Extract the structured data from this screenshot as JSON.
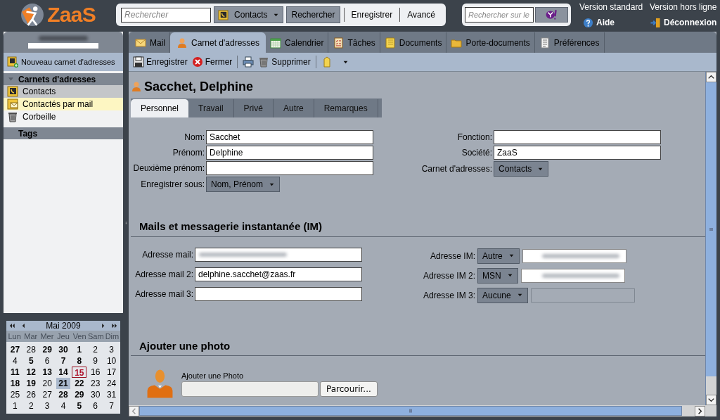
{
  "logo": {
    "text": "ZaaS"
  },
  "search": {
    "placeholder": "Rechercher",
    "scope": "Contacts",
    "buttons": [
      {
        "label": "Rechercher",
        "kind": "button"
      },
      {
        "label": "Enregistrer",
        "kind": "link"
      },
      {
        "label": "Avancé",
        "kind": "link"
      }
    ]
  },
  "web_search": {
    "placeholder": "Rechercher sur le"
  },
  "top_links": [
    {
      "label": "Version standard",
      "kind": "plain"
    },
    {
      "label": "Version hors ligne",
      "kind": "plain"
    },
    {
      "label": "Aide",
      "kind": "help"
    },
    {
      "label": "Déconnexion",
      "kind": "logout"
    }
  ],
  "sidebar": {
    "new_button": "Nouveau carnet d'adresses",
    "sections": [
      {
        "title": "Carnets d'adresses",
        "items": [
          {
            "label": "Contacts",
            "kind": "contacts",
            "selected": true,
            "highlighted": false
          },
          {
            "label": "Contactés par mail",
            "kind": "mailed",
            "selected": false,
            "highlighted": true
          },
          {
            "label": "Corbeille",
            "kind": "trash",
            "selected": false,
            "highlighted": false
          }
        ]
      },
      {
        "title": "Tags"
      }
    ]
  },
  "calendar": {
    "month": "Mai 2009",
    "weekdays": [
      "Lun",
      "Mar",
      "Mer",
      "Jeu",
      "Ven",
      "Sam",
      "Dim"
    ],
    "weeks": [
      [
        {
          "day": "27",
          "bold": true
        },
        {
          "day": "28",
          "bold": false
        },
        {
          "day": "29",
          "bold": true
        },
        {
          "day": "30",
          "bold": true
        },
        {
          "day": "1",
          "bold": true
        },
        {
          "day": "2",
          "bold": false
        },
        {
          "day": "3",
          "bold": false
        }
      ],
      [
        {
          "day": "4",
          "bold": false
        },
        {
          "day": "5",
          "bold": true
        },
        {
          "day": "6",
          "bold": false
        },
        {
          "day": "7",
          "bold": true
        },
        {
          "day": "8",
          "bold": true
        },
        {
          "day": "9",
          "bold": false
        },
        {
          "day": "10",
          "bold": false
        }
      ],
      [
        {
          "day": "11",
          "bold": true
        },
        {
          "day": "12",
          "bold": true
        },
        {
          "day": "13",
          "bold": true
        },
        {
          "day": "14",
          "bold": true
        },
        {
          "day": "15",
          "bold": true,
          "today": true
        },
        {
          "day": "16",
          "bold": false
        },
        {
          "day": "17",
          "bold": false
        }
      ],
      [
        {
          "day": "18",
          "bold": true
        },
        {
          "day": "19",
          "bold": true
        },
        {
          "day": "20",
          "bold": false
        },
        {
          "day": "21",
          "bold": true,
          "selected": true
        },
        {
          "day": "22",
          "bold": true
        },
        {
          "day": "23",
          "bold": false
        },
        {
          "day": "24",
          "bold": false
        }
      ],
      [
        {
          "day": "25",
          "bold": false
        },
        {
          "day": "26",
          "bold": false
        },
        {
          "day": "27",
          "bold": false
        },
        {
          "day": "28",
          "bold": true
        },
        {
          "day": "29",
          "bold": true
        },
        {
          "day": "30",
          "bold": false
        },
        {
          "day": "31",
          "bold": false
        }
      ],
      [
        {
          "day": "1",
          "bold": false
        },
        {
          "day": "2",
          "bold": false
        },
        {
          "day": "3",
          "bold": false
        },
        {
          "day": "4",
          "bold": false
        },
        {
          "day": "5",
          "bold": true
        },
        {
          "day": "6",
          "bold": false
        },
        {
          "day": "7",
          "bold": false
        }
      ]
    ]
  },
  "app_tabs": [
    {
      "label": "Mail",
      "kind": "mail",
      "selected": false
    },
    {
      "label": "Carnet d'adresses",
      "kind": "contact",
      "selected": true
    },
    {
      "label": "Calendrier",
      "kind": "calendar",
      "selected": false
    },
    {
      "label": "Tâches",
      "kind": "tasks",
      "selected": false
    },
    {
      "label": "Documents",
      "kind": "notebook",
      "selected": false
    },
    {
      "label": "Porte-documents",
      "kind": "folder",
      "selected": false
    },
    {
      "label": "Préférences",
      "kind": "prefs",
      "selected": false
    }
  ],
  "toolbar": [
    {
      "label": "Enregistrer",
      "kind": "save"
    },
    {
      "label": "Fermer",
      "kind": "close"
    },
    {
      "kind": "separator"
    },
    {
      "kind": "print"
    },
    {
      "label": "Supprimer",
      "kind": "delete"
    },
    {
      "kind": "separator"
    },
    {
      "kind": "tag"
    }
  ],
  "contact": {
    "title": "Sacchet, Delphine",
    "tabs": [
      {
        "label": "Personnel",
        "selected": true
      },
      {
        "label": "Travail",
        "selected": false
      },
      {
        "label": "Privé",
        "selected": false
      },
      {
        "label": "Autre",
        "selected": false
      },
      {
        "label": "Remarques",
        "selected": false
      }
    ],
    "left_fields": [
      {
        "label": "Nom:",
        "kind": "text",
        "value": "Sacchet"
      },
      {
        "label": "Prénom:",
        "kind": "text",
        "value": "Delphine"
      },
      {
        "label": "Deuxième prénom:",
        "kind": "text"
      },
      {
        "label": "Enregistrer sous:",
        "kind": "select",
        "value": "Nom, Prénom"
      }
    ],
    "right_fields": [
      {
        "label": "Fonction:",
        "kind": "text"
      },
      {
        "label": "Société:",
        "kind": "text",
        "value": "ZaaS"
      },
      {
        "label": "Carnet d'adresses:",
        "kind": "select",
        "value": "Contacts"
      }
    ],
    "mail_section": {
      "title": "Mails et messagerie instantanée (IM)",
      "mails": [
        {
          "label": "Adresse mail:",
          "blurred": true
        },
        {
          "label": "Adresse mail 2:",
          "value": "delphine.sacchet@zaas.fr",
          "blurred": false
        },
        {
          "label": "Adresse mail 3:",
          "blurred": false
        }
      ],
      "ims": [
        {
          "label": "Adresse IM:",
          "type": "Autre",
          "blurred": true,
          "disabled": false
        },
        {
          "label": "Adresse IM 2:",
          "type": "MSN",
          "blurred": true,
          "disabled": false
        },
        {
          "label": "Adresse IM 3:",
          "type": "Aucune",
          "blurred": false,
          "disabled": true
        }
      ]
    },
    "photo_section": {
      "title": "Ajouter une photo",
      "label": "Ajouter une Photo",
      "button": "Parcourir..."
    }
  }
}
